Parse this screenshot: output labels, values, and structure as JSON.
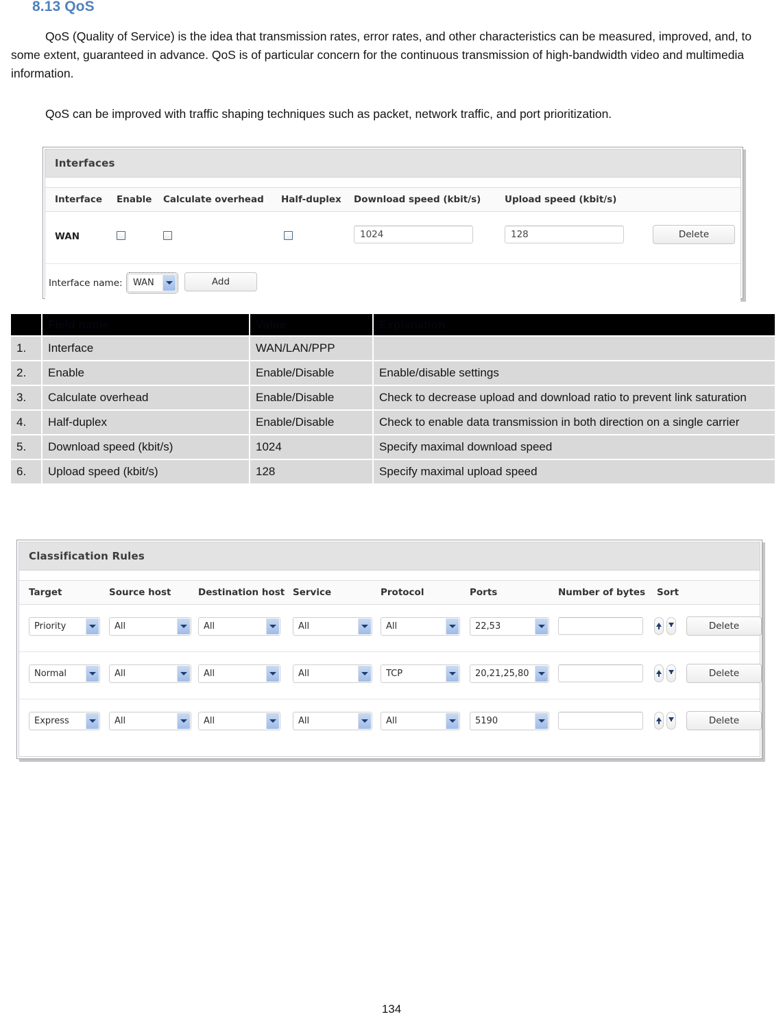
{
  "document": {
    "heading": "8.13 QoS",
    "paragraph1": "QoS (Quality of Service) is the idea that transmission rates, error rates, and other characteristics can be measured, improved, and, to some extent, guaranteed in advance. QoS is of particular concern for the continuous transmission of high-bandwidth video and multimedia information.",
    "paragraph2": "QoS can be improved with traffic shaping techniques such as packet, network traffic, and port prioritization.",
    "page_number": "134"
  },
  "interfaces_panel": {
    "title": "Interfaces",
    "columns": [
      "Interface",
      "Enable",
      "Calculate overhead",
      "Half-duplex",
      "Download speed (kbit/s)",
      "Upload speed (kbit/s)"
    ],
    "row": {
      "interface": "WAN",
      "enable_checked": false,
      "calculate_overhead_checked": false,
      "half_duplex_checked": false,
      "download_speed": "1024",
      "upload_speed": "128",
      "delete_label": "Delete"
    },
    "footer": {
      "interface_name_label": "Interface name:",
      "interface_name_value": "WAN",
      "add_label": "Add"
    }
  },
  "description_table": {
    "headers": [
      "",
      "Field name",
      "Value",
      "Explanation"
    ],
    "rows": [
      {
        "num": "1.",
        "field": "Interface",
        "value": "WAN/LAN/PPP",
        "explanation": ""
      },
      {
        "num": "2.",
        "field": "Enable",
        "value": "Enable/Disable",
        "explanation": "Enable/disable settings"
      },
      {
        "num": "3.",
        "field": "Calculate overhead",
        "value": "Enable/Disable",
        "explanation": "Check to decrease upload and download ratio to prevent link saturation"
      },
      {
        "num": "4.",
        "field": "Half-duplex",
        "value": "Enable/Disable",
        "explanation": "Check to enable data transmission in both direction on a single carrier"
      },
      {
        "num": "5.",
        "field": "Download speed (kbit/s)",
        "value": "1024",
        "explanation": "Specify maximal download speed"
      },
      {
        "num": "6.",
        "field": "Upload speed (kbit/s)",
        "value": "128",
        "explanation": "Specify maximal upload speed"
      }
    ]
  },
  "classification_panel": {
    "title": "Classification Rules",
    "columns": [
      "Target",
      "Source host",
      "Destination host",
      "Service",
      "Protocol",
      "Ports",
      "Number of bytes",
      "Sort"
    ],
    "rows": [
      {
        "target": "Priority",
        "source_host": "All",
        "destination_host": "All",
        "service": "All",
        "protocol": "All",
        "ports": "22,53",
        "number_of_bytes": "",
        "delete_label": "Delete"
      },
      {
        "target": "Normal",
        "source_host": "All",
        "destination_host": "All",
        "service": "All",
        "protocol": "TCP",
        "ports": "20,21,25,80",
        "number_of_bytes": "",
        "delete_label": "Delete"
      },
      {
        "target": "Express",
        "source_host": "All",
        "destination_host": "All",
        "service": "All",
        "protocol": "All",
        "ports": "5190",
        "number_of_bytes": "",
        "delete_label": "Delete"
      }
    ]
  },
  "colors": {
    "heading": "#4f81bd",
    "panel_header_bg": "#e3e3e3",
    "table_row_bg": "#d9d9d9",
    "table_header_bg": "#000000"
  }
}
